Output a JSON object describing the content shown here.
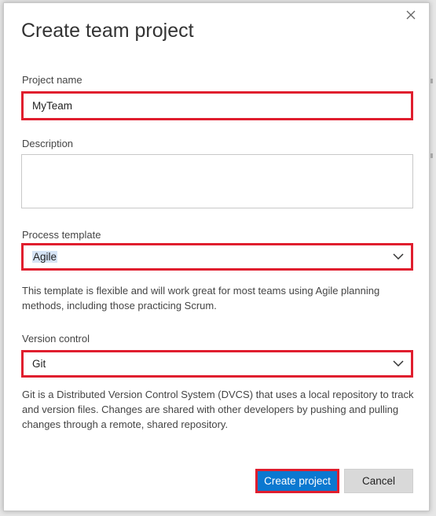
{
  "dialog": {
    "title": "Create team project",
    "close_label": "×"
  },
  "fields": {
    "project_name_label": "Project name",
    "project_name_value": "MyTeam",
    "description_label": "Description",
    "description_value": "",
    "process_template_label": "Process template",
    "process_template_value": "Agile",
    "process_template_help": "This template is flexible and will work great for most teams using Agile planning methods, including those practicing Scrum.",
    "version_control_label": "Version control",
    "version_control_value": "Git",
    "version_control_help": "Git is a Distributed Version Control System (DVCS) that uses a local repository to track and version files. Changes are shared with other developers by pushing and pulling changes through a remote, shared repository."
  },
  "buttons": {
    "create_label": "Create project",
    "cancel_label": "Cancel"
  },
  "colors": {
    "highlight": "#e01e2e",
    "primary": "#0b78d0"
  }
}
